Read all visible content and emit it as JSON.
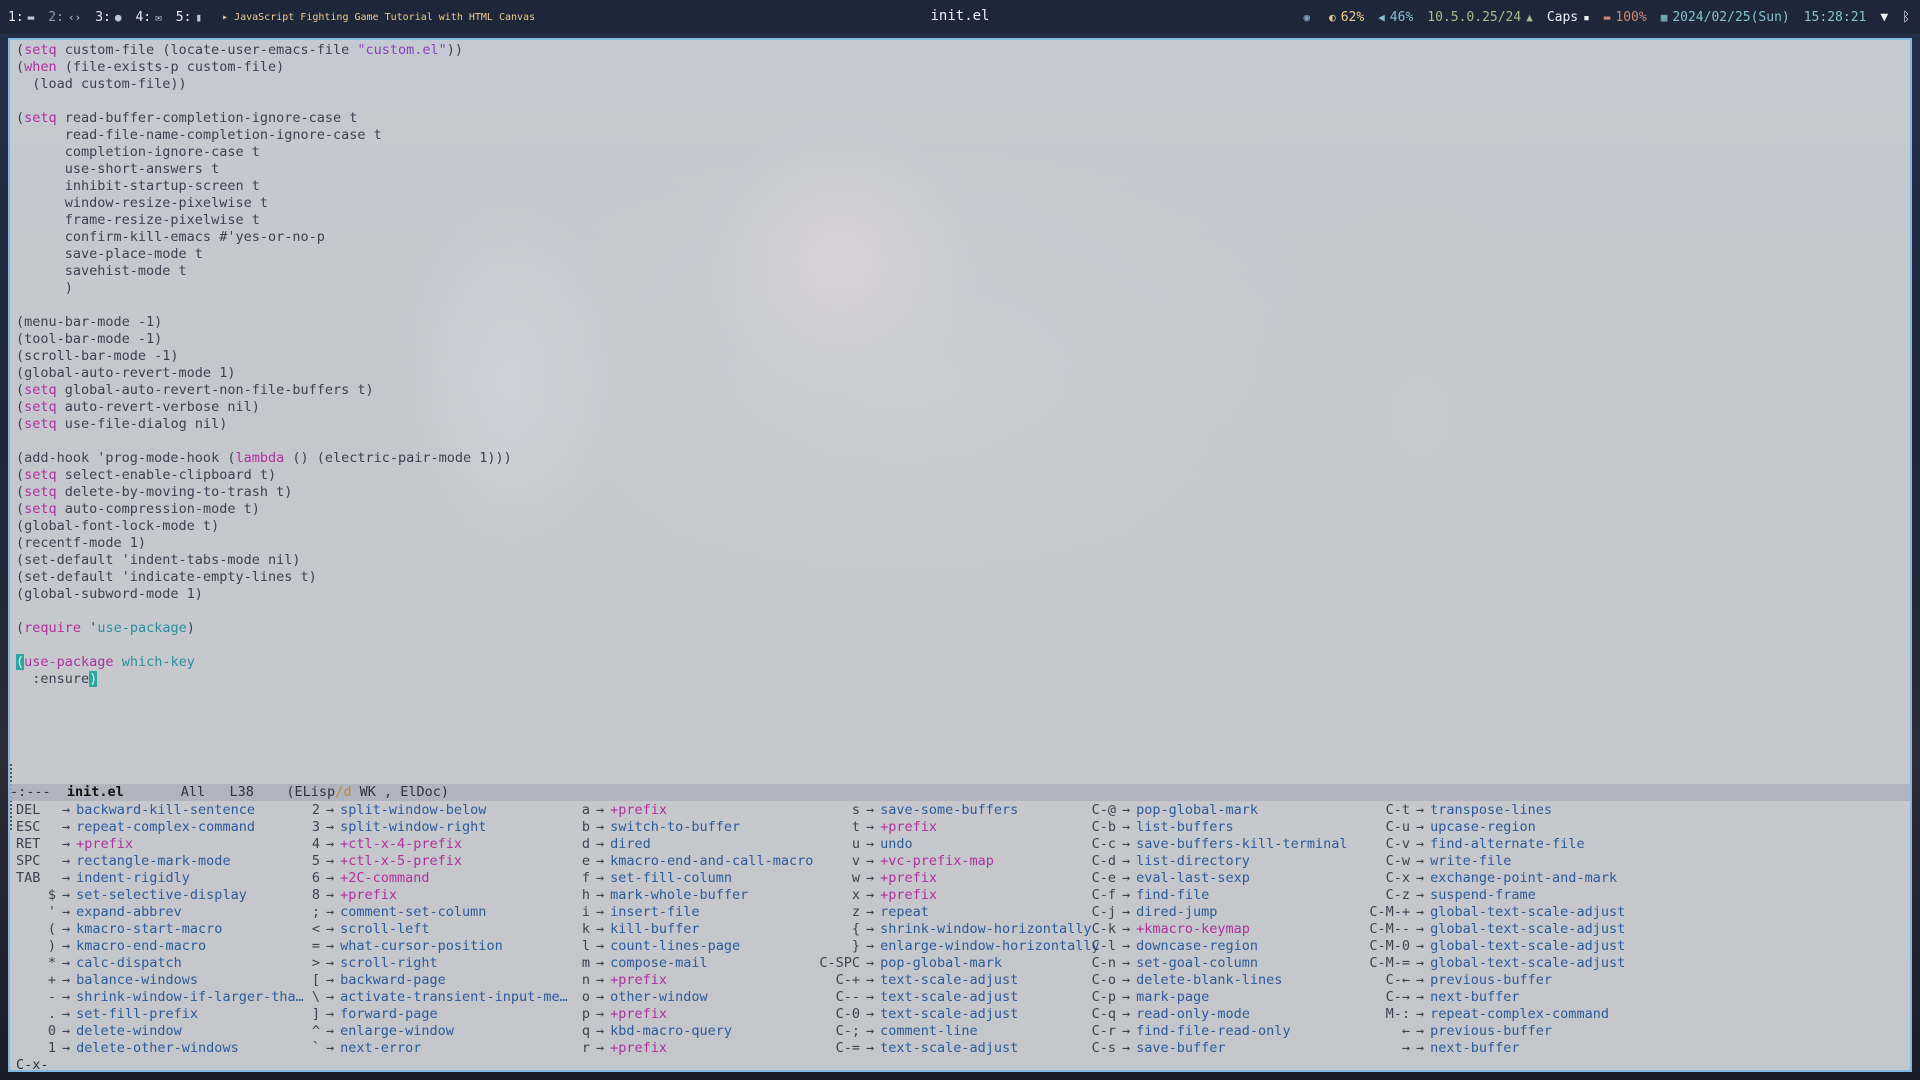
{
  "topbar": {
    "workspaces": [
      {
        "num": "1:",
        "icon": "terminal-icon",
        "glyph": "▬",
        "active": false
      },
      {
        "num": "2:",
        "icon": "code-icon",
        "glyph": "‹›",
        "active": false
      },
      {
        "num": "3:",
        "icon": "globe-icon",
        "glyph": "●",
        "active": false
      },
      {
        "num": "4:",
        "icon": "mail-icon",
        "glyph": "✉",
        "active": false
      },
      {
        "num": "5:",
        "icon": "file-icon",
        "glyph": "▮",
        "active": false
      }
    ],
    "media_title": "▸ JavaScript Fighting Game Tutorial with HTML Canvas",
    "window_title": "init.el",
    "status": {
      "brightness": "62%",
      "volume": "46%",
      "ip": "10.5.0.25/24",
      "caps": "Caps",
      "battery": "100%",
      "date": "2024/02/25(Sun)",
      "time": "15:28:21"
    },
    "colors": {
      "accent": "#88c0d0",
      "warning": "#ebcb8b",
      "ok": "#a3be8c"
    }
  },
  "editor": {
    "filename": "init.el",
    "lines": [
      "(setq custom-file (locate-user-emacs-file \"custom.el\"))",
      "(when (file-exists-p custom-file)",
      "  (load custom-file))",
      "",
      "(setq read-buffer-completion-ignore-case t",
      "      read-file-name-completion-ignore-case t",
      "      completion-ignore-case t",
      "      use-short-answers t",
      "      inhibit-startup-screen t",
      "      window-resize-pixelwise t",
      "      frame-resize-pixelwise t",
      "      confirm-kill-emacs #'yes-or-no-p",
      "      save-place-mode t",
      "      savehist-mode t",
      "      )",
      "",
      "(menu-bar-mode -1)",
      "(tool-bar-mode -1)",
      "(scroll-bar-mode -1)",
      "(global-auto-revert-mode 1)",
      "(setq global-auto-revert-non-file-buffers t)",
      "(setq auto-revert-verbose nil)",
      "(setq use-file-dialog nil)",
      "",
      "(add-hook 'prog-mode-hook (lambda () (electric-pair-mode 1)))",
      "(setq select-enable-clipboard t)",
      "(setq delete-by-moving-to-trash t)",
      "(setq auto-compression-mode t)",
      "(global-font-lock-mode t)",
      "(recentf-mode 1)",
      "(set-default 'indent-tabs-mode nil)",
      "(set-default 'indicate-empty-lines t)",
      "(global-subword-mode 1)",
      "",
      "(require 'use-package)",
      "",
      "(use-package which-key",
      "  :ensure)"
    ]
  },
  "modeline": {
    "state": "-:---",
    "buffer": "init.el",
    "position": "All",
    "line": "L38",
    "mode_open": "(ELisp",
    "mode_flag": "/d",
    "mode_rest": " WK , ElDoc)"
  },
  "whichkey": {
    "columns": [
      [
        [
          "DEL",
          "backward-kill-sentence"
        ],
        [
          "ESC",
          "repeat-complex-command"
        ],
        [
          "RET",
          "+prefix"
        ],
        [
          "SPC",
          "rectangle-mark-mode"
        ],
        [
          "TAB",
          "indent-rigidly"
        ],
        [
          "$",
          "set-selective-display"
        ],
        [
          "'",
          "expand-abbrev"
        ],
        [
          "(",
          "kmacro-start-macro"
        ],
        [
          ")",
          "kmacro-end-macro"
        ],
        [
          "*",
          "calc-dispatch"
        ],
        [
          "+",
          "balance-windows"
        ],
        [
          "-",
          "shrink-window-if-larger-tha…"
        ],
        [
          ".",
          "set-fill-prefix"
        ],
        [
          "0",
          "delete-window"
        ],
        [
          "1",
          "delete-other-windows"
        ]
      ],
      [
        [
          "2",
          "split-window-below"
        ],
        [
          "3",
          "split-window-right"
        ],
        [
          "4",
          "+ctl-x-4-prefix"
        ],
        [
          "5",
          "+ctl-x-5-prefix"
        ],
        [
          "6",
          "+2C-command"
        ],
        [
          "8",
          "+prefix"
        ],
        [
          ";",
          "comment-set-column"
        ],
        [
          "<",
          "scroll-left"
        ],
        [
          "=",
          "what-cursor-position"
        ],
        [
          ">",
          "scroll-right"
        ],
        [
          "[",
          "backward-page"
        ],
        [
          "\\",
          "activate-transient-input-me…"
        ],
        [
          "]",
          "forward-page"
        ],
        [
          "^",
          "enlarge-window"
        ],
        [
          "`",
          "next-error"
        ]
      ],
      [
        [
          "a",
          "+prefix"
        ],
        [
          "b",
          "switch-to-buffer"
        ],
        [
          "d",
          "dired"
        ],
        [
          "e",
          "kmacro-end-and-call-macro"
        ],
        [
          "f",
          "set-fill-column"
        ],
        [
          "h",
          "mark-whole-buffer"
        ],
        [
          "i",
          "insert-file"
        ],
        [
          "k",
          "kill-buffer"
        ],
        [
          "l",
          "count-lines-page"
        ],
        [
          "m",
          "compose-mail"
        ],
        [
          "n",
          "+prefix"
        ],
        [
          "o",
          "other-window"
        ],
        [
          "p",
          "+prefix"
        ],
        [
          "q",
          "kbd-macro-query"
        ],
        [
          "r",
          "+prefix"
        ]
      ],
      [
        [
          "s",
          "save-some-buffers"
        ],
        [
          "t",
          "+prefix"
        ],
        [
          "u",
          "undo"
        ],
        [
          "v",
          "+vc-prefix-map"
        ],
        [
          "w",
          "+prefix"
        ],
        [
          "x",
          "+prefix"
        ],
        [
          "z",
          "repeat"
        ],
        [
          "{",
          "shrink-window-horizontally"
        ],
        [
          "}",
          "enlarge-window-horizontally"
        ],
        [
          "C-SPC",
          "pop-global-mark"
        ],
        [
          "C-+",
          "text-scale-adjust"
        ],
        [
          "C--",
          "text-scale-adjust"
        ],
        [
          "C-0",
          "text-scale-adjust"
        ],
        [
          "C-;",
          "comment-line"
        ],
        [
          "C-=",
          "text-scale-adjust"
        ]
      ],
      [
        [
          "C-@",
          "pop-global-mark"
        ],
        [
          "C-b",
          "list-buffers"
        ],
        [
          "C-c",
          "save-buffers-kill-terminal"
        ],
        [
          "C-d",
          "list-directory"
        ],
        [
          "C-e",
          "eval-last-sexp"
        ],
        [
          "C-f",
          "find-file"
        ],
        [
          "C-j",
          "dired-jump"
        ],
        [
          "C-k",
          "+kmacro-keymap"
        ],
        [
          "C-l",
          "downcase-region"
        ],
        [
          "C-n",
          "set-goal-column"
        ],
        [
          "C-o",
          "delete-blank-lines"
        ],
        [
          "C-p",
          "mark-page"
        ],
        [
          "C-q",
          "read-only-mode"
        ],
        [
          "C-r",
          "find-file-read-only"
        ],
        [
          "C-s",
          "save-buffer"
        ]
      ],
      [
        [
          "C-t",
          "transpose-lines"
        ],
        [
          "C-u",
          "upcase-region"
        ],
        [
          "C-v",
          "find-alternate-file"
        ],
        [
          "C-w",
          "write-file"
        ],
        [
          "C-x",
          "exchange-point-and-mark"
        ],
        [
          "C-z",
          "suspend-frame"
        ],
        [
          "C-M-+",
          "global-text-scale-adjust"
        ],
        [
          "C-M--",
          "global-text-scale-adjust"
        ],
        [
          "C-M-0",
          "global-text-scale-adjust"
        ],
        [
          "C-M-=",
          "global-text-scale-adjust"
        ],
        [
          "C-←",
          "previous-buffer"
        ],
        [
          "C-→",
          "next-buffer"
        ],
        [
          "M-:",
          "repeat-complex-command"
        ],
        [
          "←",
          "previous-buffer"
        ],
        [
          "→",
          "next-buffer"
        ]
      ]
    ]
  },
  "minibuffer": {
    "text": "C-x-"
  }
}
